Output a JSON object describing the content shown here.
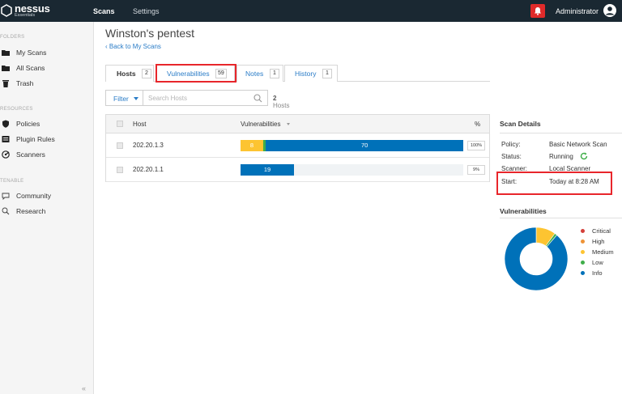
{
  "topbar": {
    "brand": "nessus",
    "brand_sub": "Essentials",
    "nav": [
      "Scans",
      "Settings"
    ],
    "user": "Administrator",
    "notification_color": "#e02a2a"
  },
  "sidebar": {
    "folders_heading": "FOLDERS",
    "folders": [
      {
        "label": "My Scans",
        "icon": "folder-icon"
      },
      {
        "label": "All Scans",
        "icon": "folder-icon"
      },
      {
        "label": "Trash",
        "icon": "trash-icon"
      }
    ],
    "resources_heading": "RESOURCES",
    "resources": [
      {
        "label": "Policies",
        "icon": "policies-icon"
      },
      {
        "label": "Plugin Rules",
        "icon": "plugin-rules-icon"
      },
      {
        "label": "Scanners",
        "icon": "scanners-icon"
      }
    ],
    "tenable_heading": "TENABLE",
    "tenable": [
      {
        "label": "Community",
        "icon": "community-icon"
      },
      {
        "label": "Research",
        "icon": "research-icon"
      }
    ],
    "collapse": "«"
  },
  "main": {
    "title": "Winston's pentest",
    "back": "‹ Back to My Scans",
    "tabs": [
      {
        "label": "Hosts",
        "count": "2",
        "active": true
      },
      {
        "label": "Vulnerabilities",
        "count": "59",
        "active": false
      },
      {
        "label": "Notes",
        "count": "1",
        "active": false
      },
      {
        "label": "History",
        "count": "1",
        "active": false
      }
    ],
    "filter_label": "Filter",
    "search_placeholder": "Search Hosts",
    "host_count": "2",
    "host_count_label": "Hosts",
    "table": {
      "headers": {
        "host": "Host",
        "vulnerabilities": "Vulnerabilities",
        "pct": "%"
      },
      "rows": [
        {
          "host": "202.20.1.3",
          "segments": [
            {
              "severity": "medium",
              "value": 8,
              "label": "8"
            },
            {
              "severity": "low",
              "value": 1,
              "label": ""
            },
            {
              "severity": "info",
              "value": 70,
              "label": "70"
            }
          ],
          "pct": "100%"
        },
        {
          "host": "202.20.1.1",
          "segments": [
            {
              "severity": "info",
              "value": 19,
              "label": "19"
            }
          ],
          "pct": "9%"
        }
      ]
    }
  },
  "scan_details": {
    "title": "Scan Details",
    "items": [
      {
        "key": "Policy:",
        "value": "Basic Network Scan"
      },
      {
        "key": "Status:",
        "value": "Running"
      },
      {
        "key": "Scanner:",
        "value": "Local Scanner"
      },
      {
        "key": "Start:",
        "value": "Today at 8:28 AM"
      }
    ]
  },
  "vulnerabilities_chart": {
    "title": "Vulnerabilities",
    "legend": [
      {
        "label": "Critical",
        "color": "#d43f3a"
      },
      {
        "label": "High",
        "color": "#ee9336"
      },
      {
        "label": "Medium",
        "color": "#fdc431"
      },
      {
        "label": "Low",
        "color": "#3fae49"
      },
      {
        "label": "Info",
        "color": "#0071b9"
      }
    ],
    "values": {
      "critical": 0,
      "high": 0,
      "medium": 8,
      "low": 1,
      "info": 70
    }
  },
  "colors": {
    "critical": "#d43f3a",
    "high": "#ee9336",
    "medium": "#fdc431",
    "low": "#3fae49",
    "info": "#0071b9",
    "link": "#2a7cc7",
    "topbar": "#1a2832",
    "highlight": "#e8262b"
  }
}
